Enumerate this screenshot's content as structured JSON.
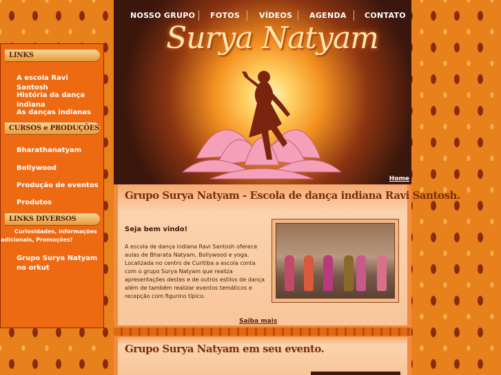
{
  "nav": [
    "NOSSO GRUPO",
    "FOTOS",
    "VÍDEOS",
    "AGENDA",
    "CONTATO"
  ],
  "brand": "Surya Natyam",
  "home_link": "Home",
  "sidebar": {
    "links_header": "LINKS",
    "links": [
      "A escola Ravi Santosh",
      "História da dança indiana",
      "As danças indianas"
    ],
    "cursos_header": "CURSOS e PRODUÇÕES",
    "cursos": [
      "Bharathanatyam",
      "Bollywood",
      "Produção de eventos",
      "Produtos"
    ],
    "diversos_header": "LINKS DIVERSOS",
    "diversos_note": "Curiosidades, informações adicionais, Promoções!",
    "diversos": [
      "Grupo Surya Natyam no orkut"
    ]
  },
  "main": {
    "card1_title": "Grupo Surya Natyam - Escola de dança indiana Ravi Santosh.",
    "welcome": "Seja bem vindo!",
    "body": "A escola de dança indiana Ravi Santosh oferece aulas de Bharata Natyam, Bollywood e yoga. Localizada no centro de Curitiba a escola conta com o grupo Surya Natyam que realiza apresentações destes e de outros estilos de dança além de também realizar eventos temáticos e recepção com figurino típico.",
    "more_link": "Saiba mais",
    "card2_title": "Grupo Surya Natyam em seu evento."
  },
  "colors": {
    "accent": "#ed6a12",
    "header_text": "#7a2e08"
  }
}
